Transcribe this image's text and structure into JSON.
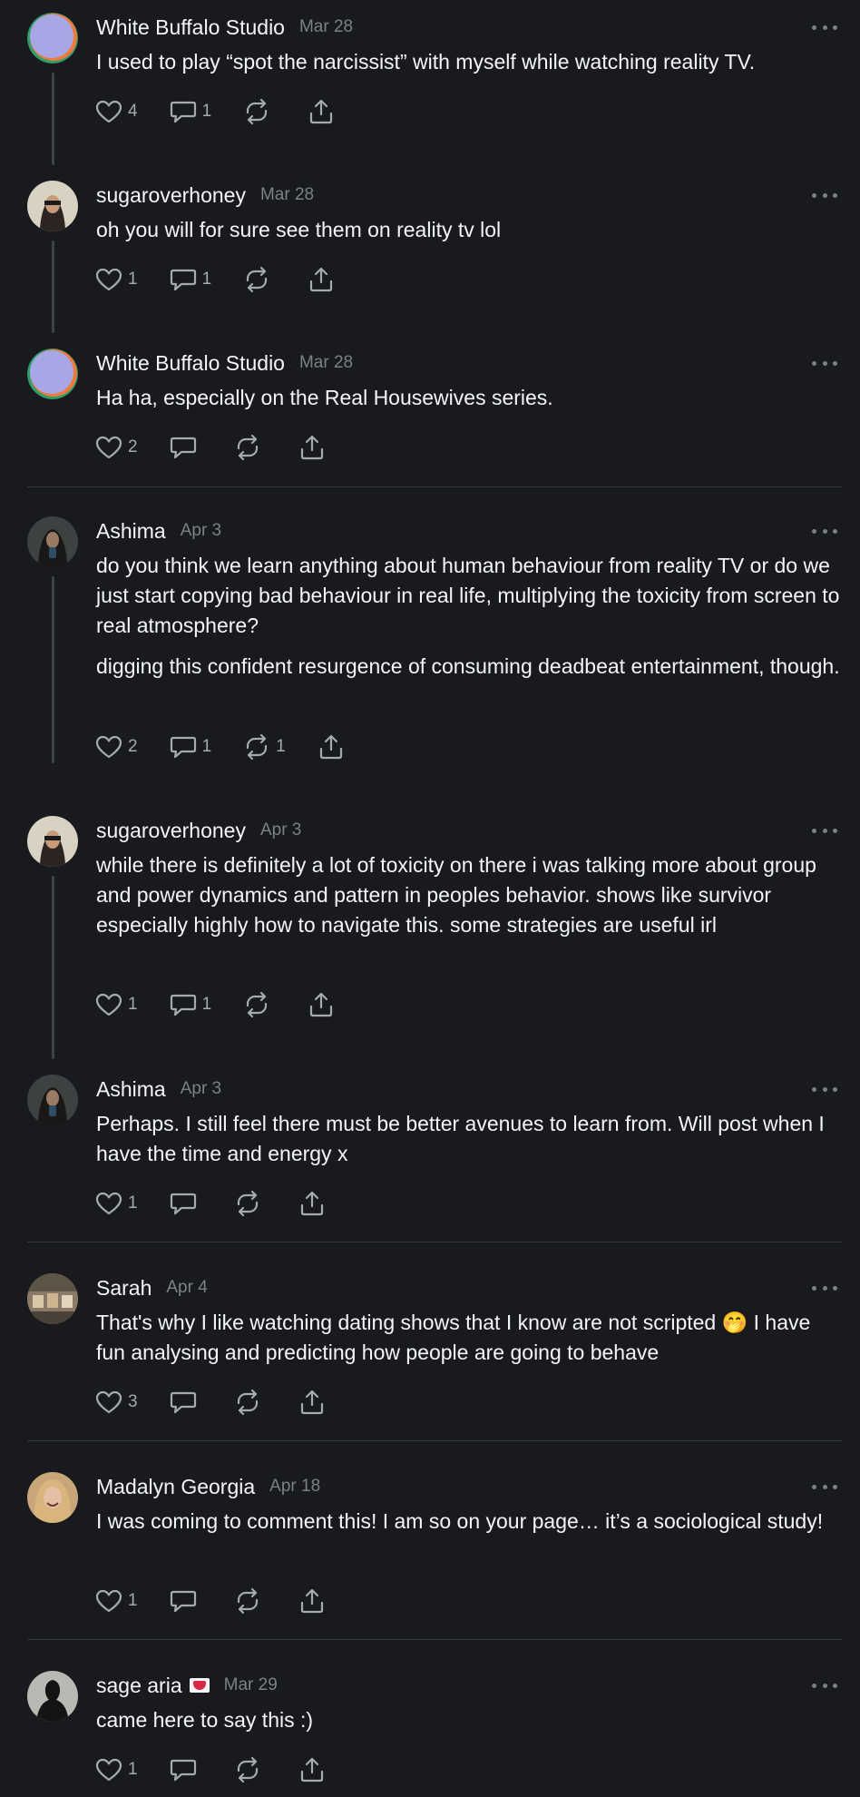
{
  "comments": [
    {
      "author": "White Buffalo Studio",
      "date": "Mar 28",
      "paragraphs": [
        "I used to play “spot the narcissist” with myself while watching reality TV."
      ],
      "likes": "4",
      "replies": "1",
      "reposts": ""
    },
    {
      "author": "sugaroverhoney",
      "date": "Mar 28",
      "paragraphs": [
        "oh you will for sure see them on reality tv lol"
      ],
      "likes": "1",
      "replies": "1",
      "reposts": ""
    },
    {
      "author": "White Buffalo Studio",
      "date": "Mar 28",
      "paragraphs": [
        "Ha ha, especially on the Real Housewives series."
      ],
      "likes": "2",
      "replies": "",
      "reposts": ""
    },
    {
      "author": "Ashima",
      "date": "Apr 3",
      "paragraphs": [
        "do you think we learn anything about human behaviour from reality TV or do we just start copying bad behaviour in real life, multiplying the toxicity from screen to real atmosphere?",
        "digging this confident resurgence of consuming deadbeat entertainment, though."
      ],
      "likes": "2",
      "replies": "1",
      "reposts": "1"
    },
    {
      "author": "sugaroverhoney",
      "date": "Apr 3",
      "paragraphs": [
        "while there is definitely a lot of toxicity on there i was talking more about group and power dynamics and pattern in peoples behavior. shows like survivor especially highly how to navigate this. some strategies are useful irl"
      ],
      "likes": "1",
      "replies": "1",
      "reposts": ""
    },
    {
      "author": "Ashima",
      "date": "Apr 3",
      "paragraphs": [
        "Perhaps. I still feel there must be better avenues to learn from. Will post when I have the time and energy x"
      ],
      "likes": "1",
      "replies": "",
      "reposts": ""
    },
    {
      "author": "Sarah",
      "date": "Apr 4",
      "paragraphs": [
        "That's why I like watching dating shows that I know are not scripted 🤭 I have fun analysing and predicting how people are going to behave"
      ],
      "likes": "3",
      "replies": "",
      "reposts": ""
    },
    {
      "author": "Madalyn Georgia",
      "date": "Apr 18",
      "paragraphs": [
        "I was coming to comment this! I am so on your page… it’s a sociological study!"
      ],
      "likes": "1",
      "replies": "",
      "reposts": ""
    },
    {
      "author": "sage aria",
      "date": "Mar 29",
      "paragraphs": [
        "came here to say this :)"
      ],
      "likes": "1",
      "replies": "",
      "reposts": ""
    }
  ],
  "icons": {
    "like": "heart-icon",
    "reply": "comment-bubble-icon",
    "repost": "repost-icon",
    "share": "share-icon",
    "more": "more-horizontal-icon",
    "flag": "heart-letter-emoji"
  },
  "colors": {
    "background": "#181a1d",
    "text": "#f3f5f7",
    "secondary": "#7d8186",
    "icon": "#a6a9ad",
    "thread_line": "#404348",
    "divider": "#33363a"
  }
}
